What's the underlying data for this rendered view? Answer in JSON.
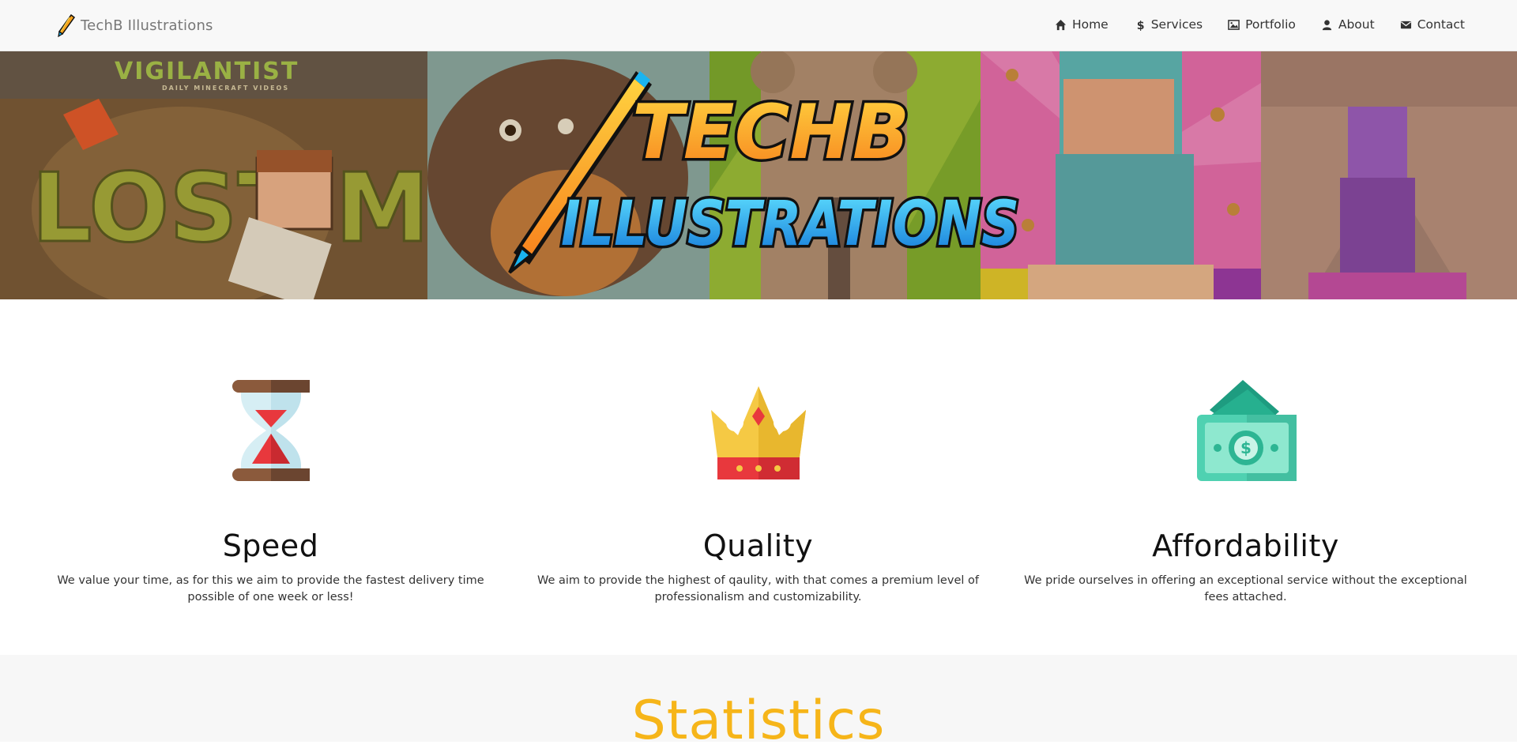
{
  "brand": {
    "name": "TechB Illustrations"
  },
  "nav": {
    "items": [
      {
        "label": "Home",
        "icon": "home-icon"
      },
      {
        "label": "Services",
        "icon": "dollar-icon"
      },
      {
        "label": "Portfolio",
        "icon": "picture-icon"
      },
      {
        "label": "About",
        "icon": "user-icon"
      },
      {
        "label": "Contact",
        "icon": "envelope-icon"
      }
    ]
  },
  "banner": {
    "logo_line1": "TECHB",
    "logo_line2": "ILLUSTRATIONS",
    "panel_tag": "VIGILANTIST",
    "panel_tag_sub": "DAILY MINECRAFT VIDEOS",
    "panel_text": "LOST MC"
  },
  "features": [
    {
      "title": "Speed",
      "description": "We value your time, as for this we aim to provide the fastest delivery time possible of one week or less!",
      "icon": "hourglass-icon"
    },
    {
      "title": "Quality",
      "description": "We aim to provide the highest of qaulity, with that comes a premium level of professionalism and customizability.",
      "icon": "crown-icon"
    },
    {
      "title": "Affordability",
      "description": "We pride ourselves in offering an exceptional service without the exceptional fees attached.",
      "icon": "money-icon"
    }
  ],
  "stats": {
    "title": "Statistics"
  },
  "colors": {
    "accent": "#f6b519",
    "navbar_bg": "#f8f8f8",
    "logo_blue": "#1ab4f0",
    "logo_orange": "#f7931e"
  }
}
